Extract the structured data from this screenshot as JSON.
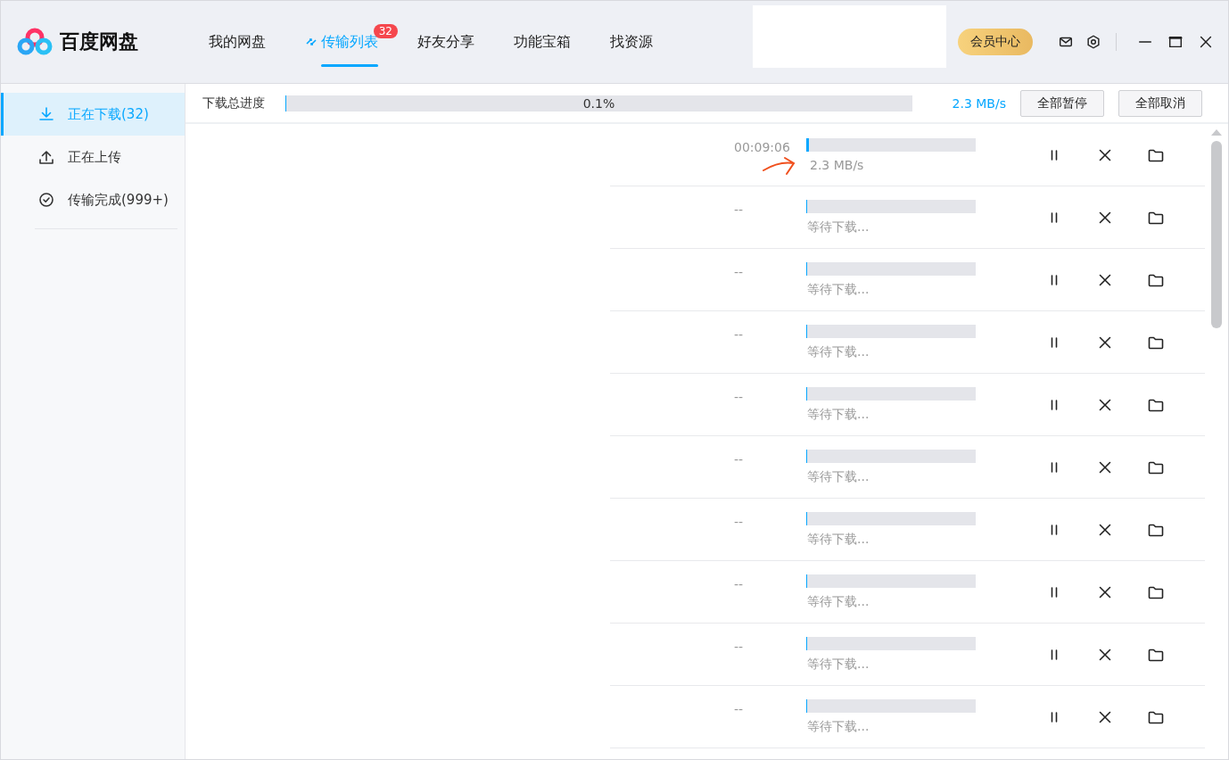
{
  "app": {
    "name": "百度网盘"
  },
  "nav": [
    {
      "label": "我的网盘",
      "selected": false
    },
    {
      "label": "传输列表",
      "selected": true,
      "badge": "32"
    },
    {
      "label": "好友分享",
      "selected": false
    },
    {
      "label": "功能宝箱",
      "selected": false
    },
    {
      "label": "找资源",
      "selected": false
    }
  ],
  "vip_button": "会员中心",
  "sidebar": {
    "items": [
      {
        "label": "正在下载(32)",
        "selected": true
      },
      {
        "label": "正在上传",
        "selected": false
      },
      {
        "label": "传输完成(999+)",
        "selected": false
      }
    ]
  },
  "summary": {
    "label": "下载总进度",
    "level": 0.001,
    "percent": "0.1%",
    "speed": "2.3 MB/s",
    "buttons": [
      "全部暂停",
      "全部取消"
    ]
  },
  "downloads": [
    {
      "time": "00:09:06",
      "level": 0.015,
      "status": "2.3 MB/s",
      "active": true
    },
    {
      "time": "--",
      "level": 0,
      "status": "等待下载...",
      "active": false
    },
    {
      "time": "--",
      "level": 0,
      "status": "等待下载...",
      "active": false
    },
    {
      "time": "--",
      "level": 0,
      "status": "等待下载...",
      "active": false
    },
    {
      "time": "--",
      "level": 0,
      "status": "等待下载...",
      "active": false
    },
    {
      "time": "--",
      "level": 0,
      "status": "等待下载...",
      "active": false
    },
    {
      "time": "--",
      "level": 0,
      "status": "等待下载...",
      "active": false
    },
    {
      "time": "--",
      "level": 0,
      "status": "等待下载...",
      "active": false
    },
    {
      "time": "--",
      "level": 0,
      "status": "等待下载...",
      "active": false
    },
    {
      "time": "--",
      "level": 0,
      "status": "等待下载...",
      "active": false
    }
  ]
}
